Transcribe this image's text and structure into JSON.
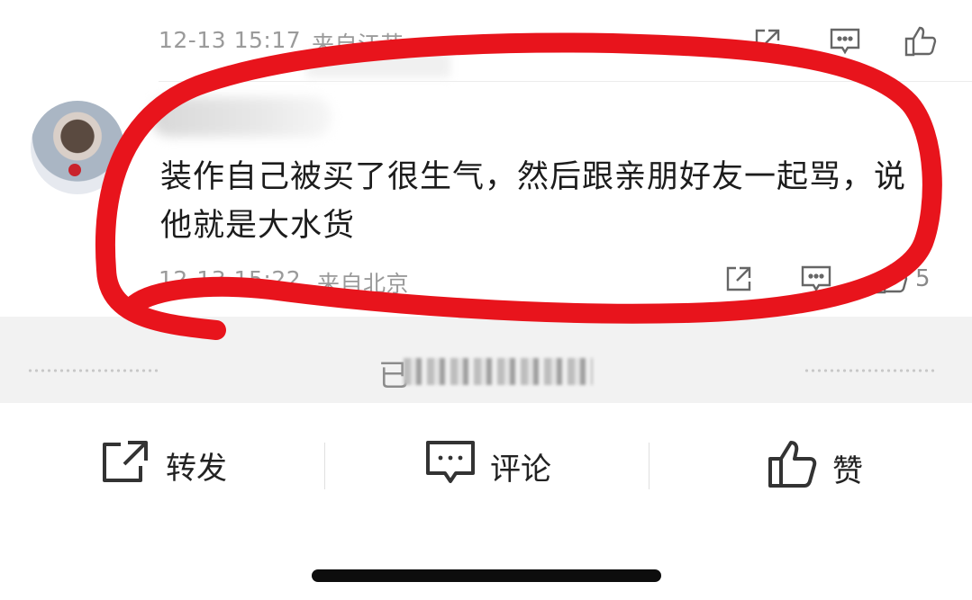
{
  "prev_comment": {
    "timestamp": "12-13 15:17",
    "location": "来自江苏"
  },
  "comment": {
    "username": "",
    "text": "装作自己被买了很生气，然后跟亲朋好友一起骂，说他就是大水货",
    "timestamp": "12-13 15:22",
    "location": "来自北京",
    "like_count": "5"
  },
  "band": {
    "text_prefix": "已"
  },
  "bottom_bar": {
    "repost_label": "转发",
    "comment_label": "评论",
    "like_label": "赞"
  },
  "colors": {
    "marker": "#e8141c",
    "band_bg": "#f2f2f2",
    "meta_text": "#9a9a9a"
  },
  "icons": {
    "repost": "repost-icon",
    "comment": "comment-icon",
    "like": "thumbs-up-icon"
  }
}
